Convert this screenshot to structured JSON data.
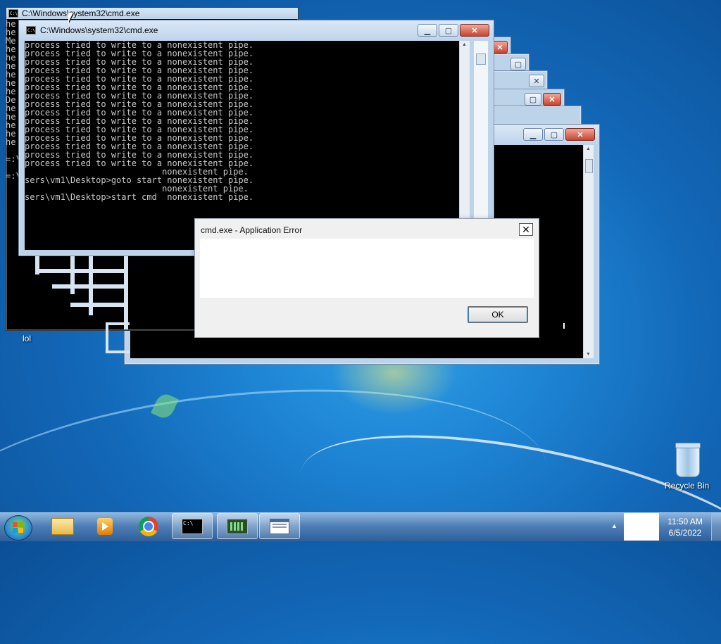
{
  "desktop": {
    "icons": [
      {
        "label": "lol"
      },
      {
        "label": "Recycle Bin"
      }
    ]
  },
  "windows": {
    "back": {
      "title": "C:\\Windows\\system32\\cmd.exe"
    },
    "main": {
      "title": "C:\\Windows\\system32\\cmd.exe",
      "left_edge_fragments": [
        "he",
        "he",
        "Me",
        "he",
        "he",
        "he",
        "he",
        "he",
        "he",
        "De",
        "he",
        "he",
        "he",
        "he",
        "he",
        "",
        "=:\\",
        "",
        "=:\\"
      ],
      "console_lines": [
        "process tried to write to a nonexistent pipe.",
        "process tried to write to a nonexistent pipe.",
        "process tried to write to a nonexistent pipe.",
        "process tried to write to a nonexistent pipe.",
        "process tried to write to a nonexistent pipe.",
        "process tried to write to a nonexistent pipe.",
        "process tried to write to a nonexistent pipe.",
        "process tried to write to a nonexistent pipe.",
        "process tried to write to a nonexistent pipe.",
        "process tried to write to a nonexistent pipe.",
        "process tried to write to a nonexistent pipe.",
        "process tried to write to a nonexistent pipe.",
        "process tried to write to a nonexistent pipe.",
        "process tried to write to a nonexistent pipe.",
        "process tried to write to a nonexistent pipe.",
        "                           nonexistent pipe.",
        "sers\\vm1\\Desktop>goto start nonexistent pipe.",
        "                           nonexistent pipe.",
        "sers\\vm1\\Desktop>start cmd  nonexistent pipe."
      ]
    }
  },
  "dialog": {
    "title": "cmd.exe - Application Error",
    "close_glyph": "✕",
    "message": "",
    "ok_label": "OK"
  },
  "taskbar": {
    "clock_time": "11:50 AM",
    "clock_date": "6/5/2022",
    "tray_arrow": "▲"
  },
  "icons": {
    "start": "windows-start-icon",
    "explorer": "folder-icon",
    "media": "media-player-icon",
    "chrome": "chrome-icon",
    "cmd": "cmd-icon",
    "task1": "task-manager-icon",
    "task2": "window-icon"
  }
}
